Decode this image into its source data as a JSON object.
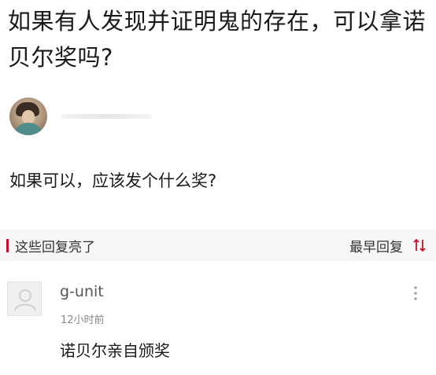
{
  "question": {
    "title": "如果有人发现并证明鬼的存在，可以拿诺贝尔奖吗?",
    "detail": "如果可以，应该发个什么奖?"
  },
  "replies_section": {
    "title": "这些回复亮了",
    "sort_label": "最早回复",
    "accent_color": "#c8102e",
    "sort_icon": "sort-arrows-icon"
  },
  "comments": [
    {
      "username": "g-unit",
      "time": "12小时前",
      "body": "诺贝尔亲自颁奖",
      "more_icon": "more-vertical-icon"
    }
  ]
}
